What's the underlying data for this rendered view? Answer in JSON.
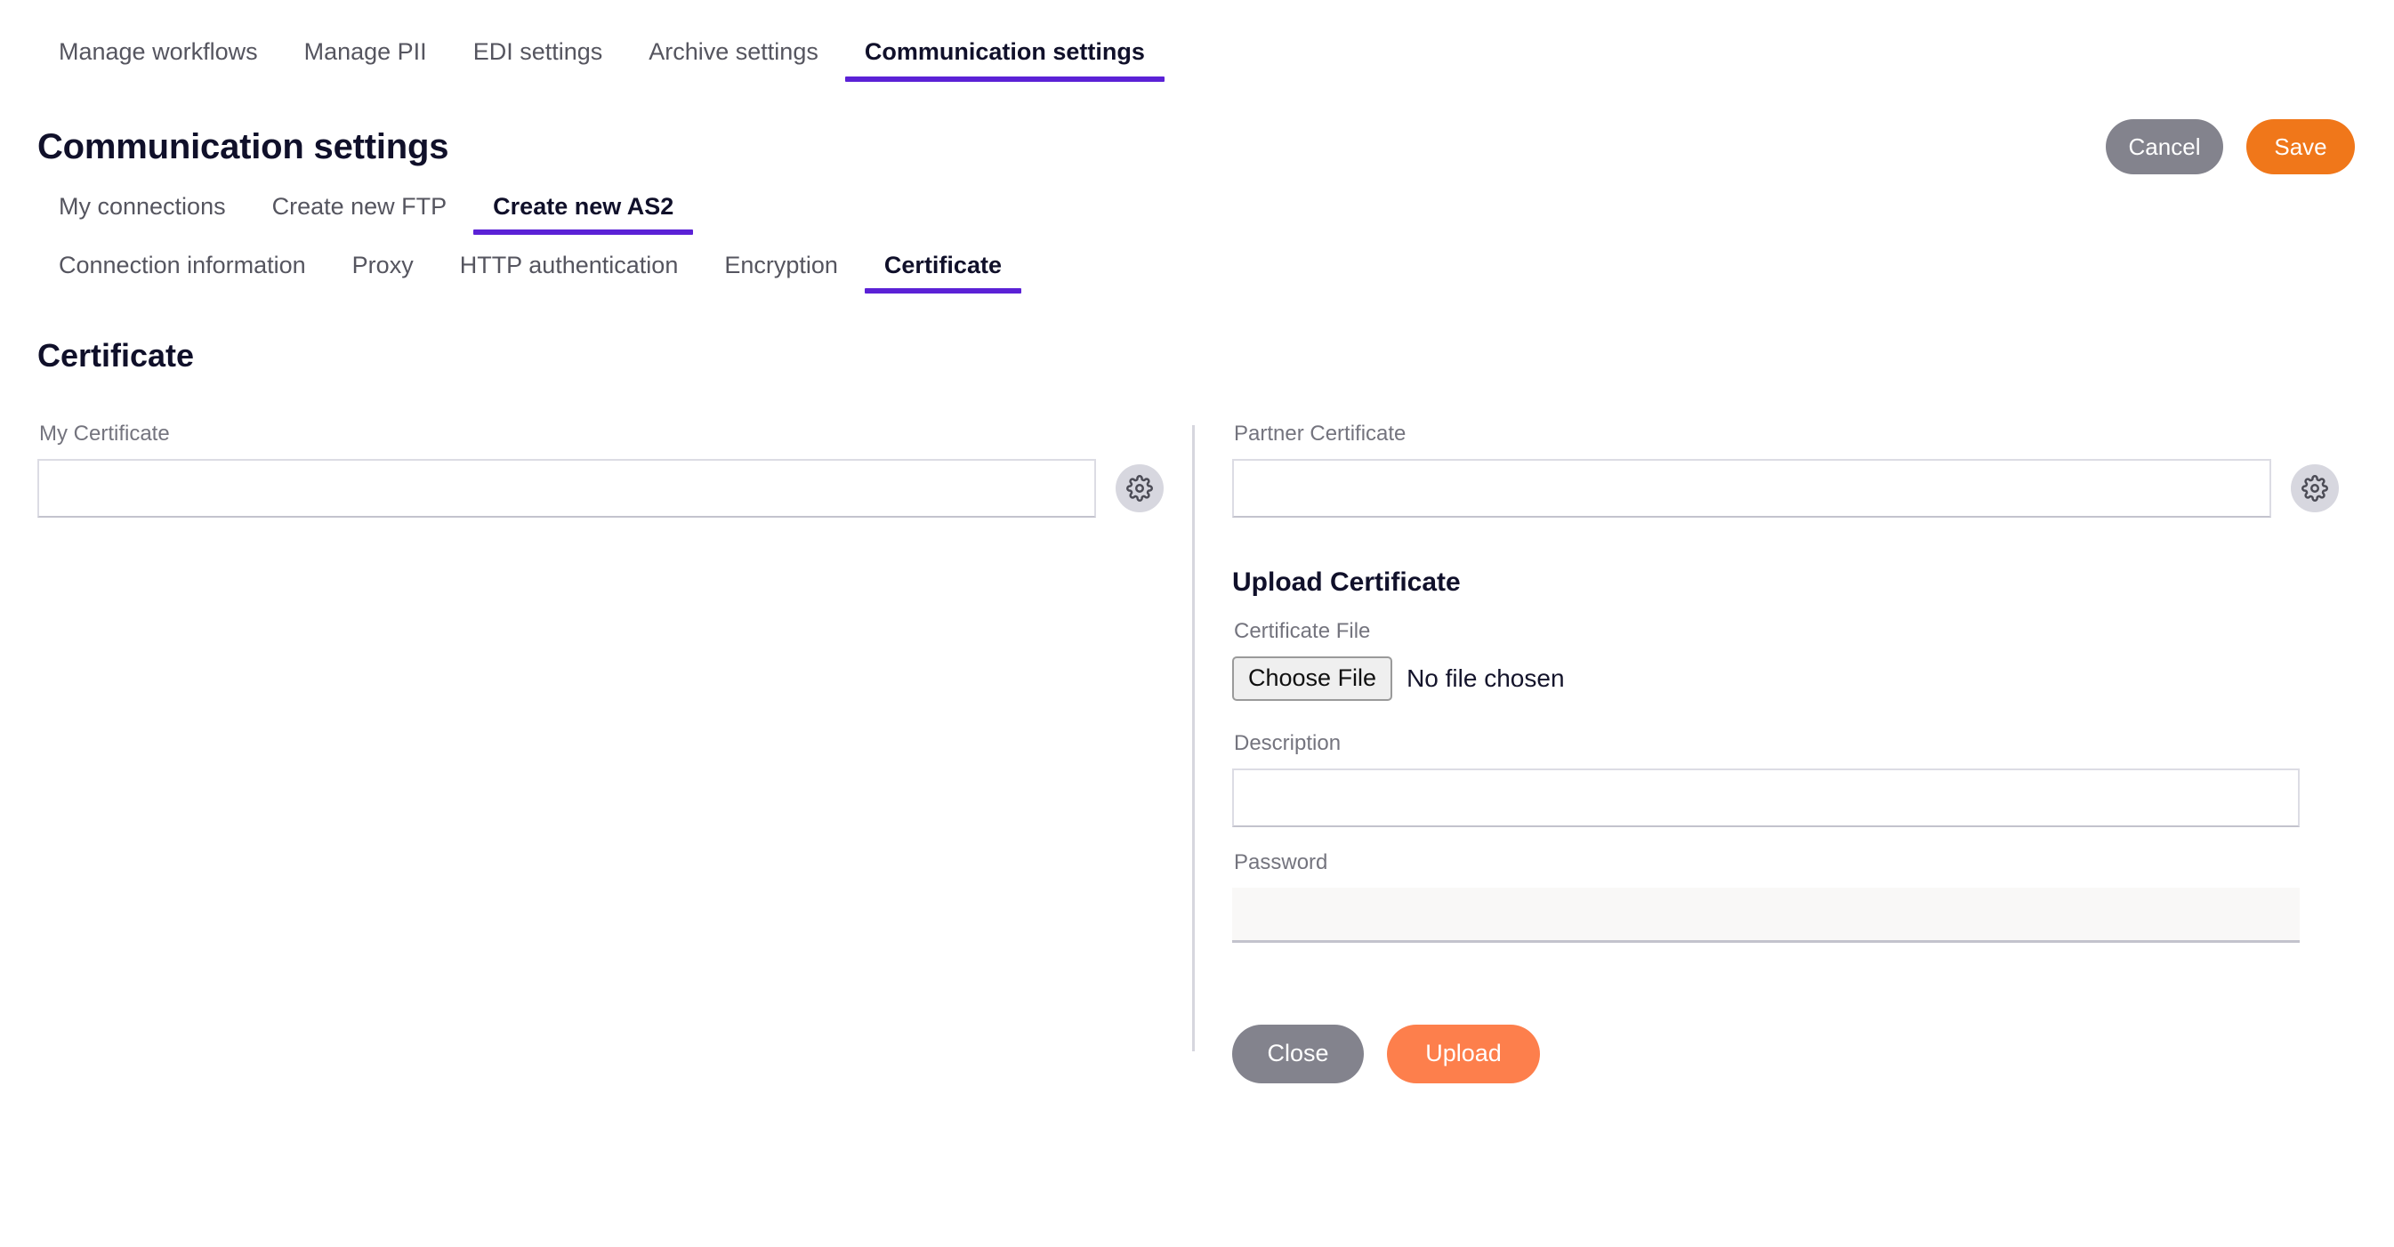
{
  "nav_primary": {
    "items": [
      {
        "label": "Manage workflows",
        "active": false
      },
      {
        "label": "Manage PII",
        "active": false
      },
      {
        "label": "EDI settings",
        "active": false
      },
      {
        "label": "Archive settings",
        "active": false
      },
      {
        "label": "Communication settings",
        "active": true
      }
    ]
  },
  "header": {
    "title": "Communication settings",
    "cancel_label": "Cancel",
    "save_label": "Save"
  },
  "nav_secondary": {
    "items": [
      {
        "label": "My connections",
        "active": false
      },
      {
        "label": "Create new FTP",
        "active": false
      },
      {
        "label": "Create new AS2",
        "active": true
      }
    ]
  },
  "nav_tertiary": {
    "items": [
      {
        "label": "Connection information",
        "active": false
      },
      {
        "label": "Proxy",
        "active": false
      },
      {
        "label": "HTTP authentication",
        "active": false
      },
      {
        "label": "Encryption",
        "active": false
      },
      {
        "label": "Certificate",
        "active": true
      }
    ]
  },
  "section": {
    "heading": "Certificate"
  },
  "my_certificate": {
    "label": "My Certificate",
    "value": "",
    "settings_icon": "gear-icon"
  },
  "partner_certificate": {
    "label": "Partner Certificate",
    "value": "",
    "settings_icon": "gear-icon"
  },
  "upload": {
    "heading": "Upload Certificate",
    "file_label": "Certificate File",
    "file_button_label": "Choose File",
    "file_status": "No file chosen",
    "description_label": "Description",
    "description_value": "",
    "password_label": "Password",
    "password_value": "",
    "close_label": "Close",
    "upload_label": "Upload"
  },
  "colors": {
    "accent_purple": "#5b21d6",
    "save_orange": "#f0771a",
    "upload_orange": "#fd7f4c",
    "gray_button": "#83838d",
    "title_navy": "#10102a",
    "label_gray": "#74747e",
    "border_gray": "#dcdce4",
    "password_fill": "#f9f8f7"
  }
}
